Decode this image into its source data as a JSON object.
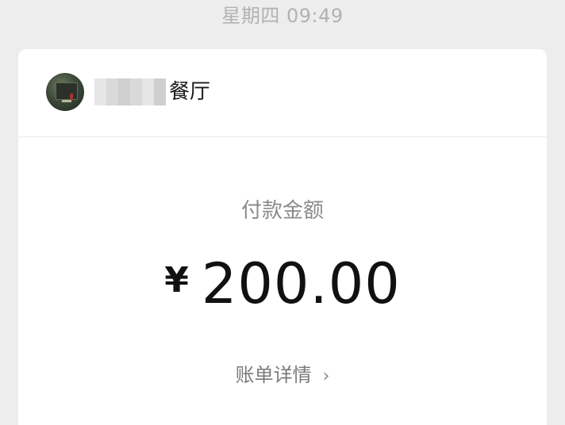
{
  "timestamp": "星期四 09:49",
  "merchant": {
    "name_visible": "餐厅"
  },
  "payment": {
    "label": "付款金额",
    "currency_symbol": "¥",
    "amount": "200.00"
  },
  "detail_link": {
    "label": "账单详情",
    "chevron": "›"
  }
}
